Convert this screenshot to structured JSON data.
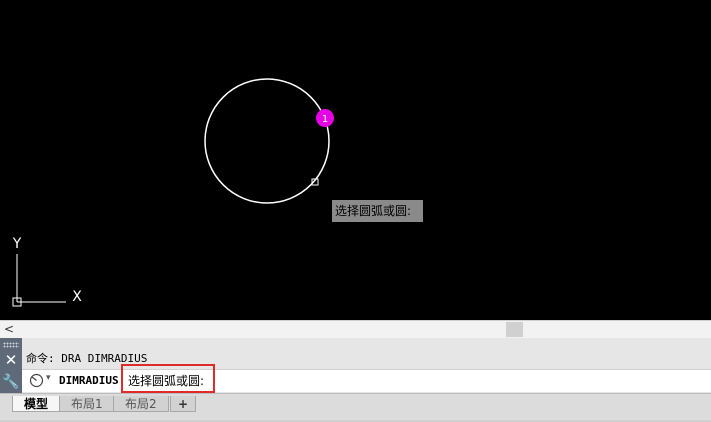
{
  "canvas": {
    "grip_number": "1",
    "tooltip": "选择圆弧或圆:",
    "ucs_x_label": "X",
    "ucs_y_label": "Y"
  },
  "command_window": {
    "history_text": "命令: DRA DIMRADIUS",
    "command_name": "DIMRADIUS",
    "prompt_text": "选择圆弧或圆:",
    "dropdown_glyph": "▾",
    "close_glyph": "✕",
    "settings_glyph": "🔧"
  },
  "scrollbar": {
    "left_arrow": "<"
  },
  "tabs": [
    {
      "label": "模型"
    },
    {
      "label": "布局1"
    },
    {
      "label": "布局2"
    },
    {
      "label": "+"
    }
  ],
  "colors": {
    "background": "#000000",
    "grip": "#e600e6",
    "highlight": "#e02a2a"
  }
}
